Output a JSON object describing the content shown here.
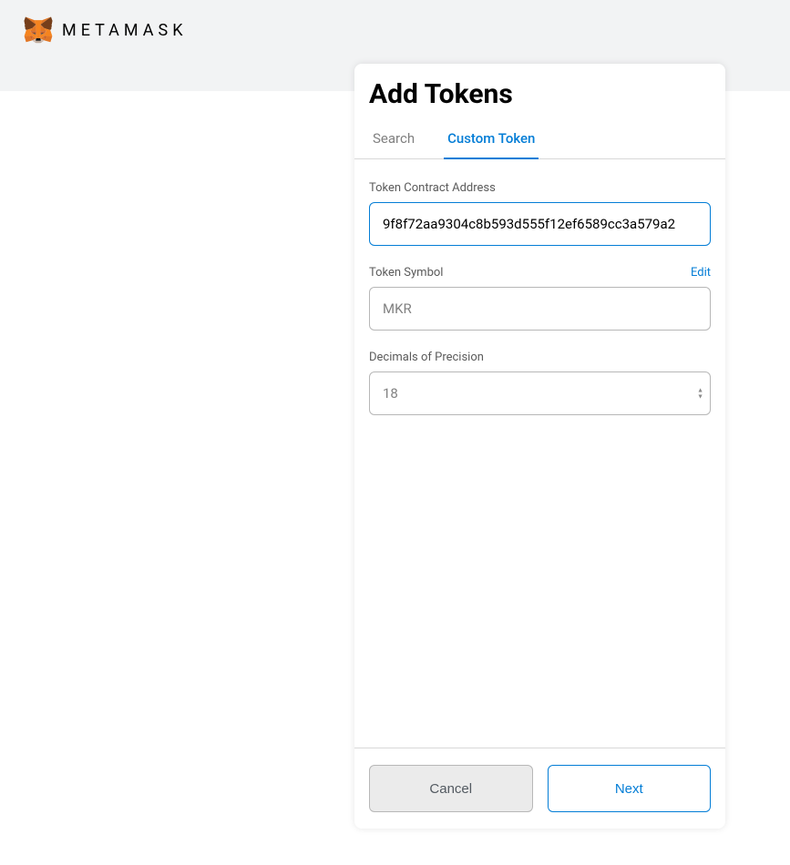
{
  "brand": {
    "name": "METAMASK"
  },
  "modal": {
    "title": "Add Tokens",
    "tabs": {
      "search": "Search",
      "custom": "Custom Token"
    },
    "fields": {
      "address": {
        "label": "Token Contract Address",
        "value": "9f8f72aa9304c8b593d555f12ef6589cc3a579a2"
      },
      "symbol": {
        "label": "Token Symbol",
        "edit": "Edit",
        "value": "MKR"
      },
      "decimals": {
        "label": "Decimals of Precision",
        "value": "18"
      }
    },
    "footer": {
      "cancel": "Cancel",
      "next": "Next"
    }
  }
}
